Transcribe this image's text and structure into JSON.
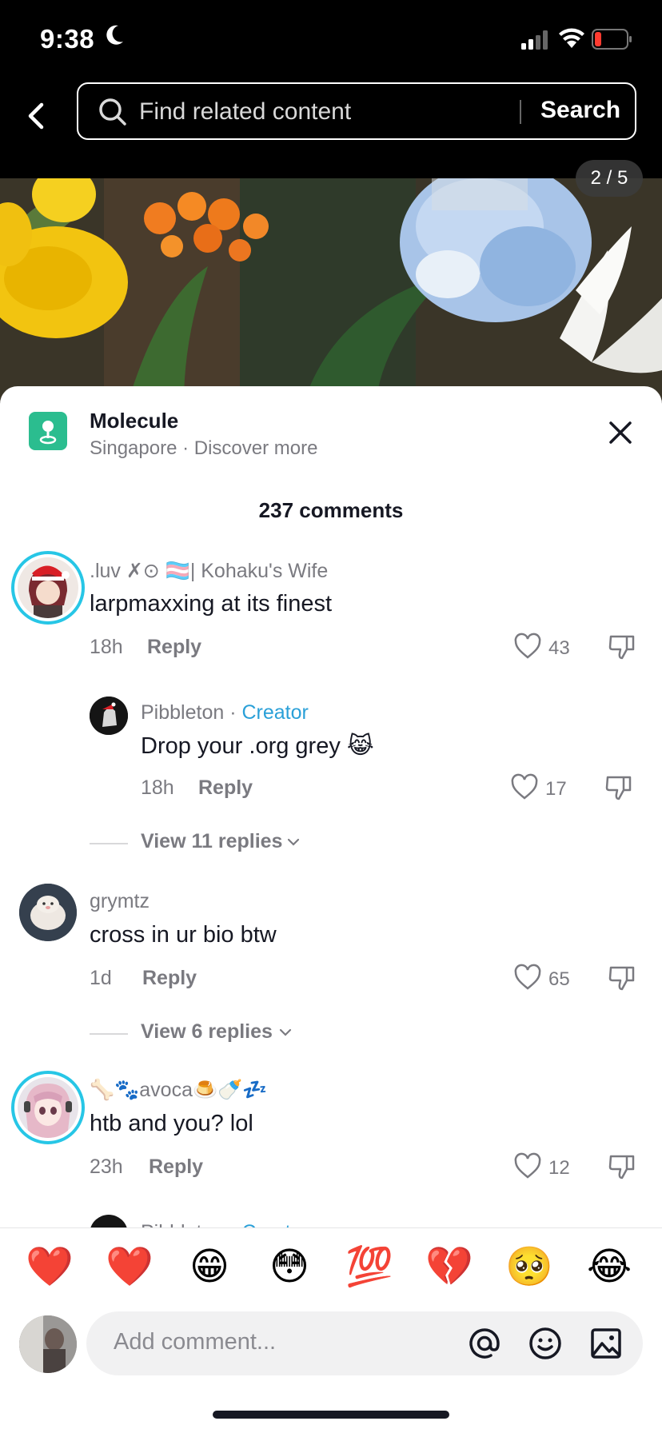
{
  "status_bar": {
    "time": "9:38"
  },
  "search": {
    "placeholder": "Find related content",
    "button": "Search"
  },
  "hero": {
    "page_indicator": "2 / 5"
  },
  "location": {
    "title": "Molecule",
    "subtitle": "Singapore · Discover more"
  },
  "comments_header": {
    "count_label": "237 comments"
  },
  "comments": [
    {
      "user": ".luv ✗⊙ 🏳️‍⚧️| Kohaku's Wife",
      "text": "larpmaxxing at its finest",
      "time": "18h",
      "reply": "Reply",
      "likes": "43"
    },
    {
      "user": "Pibbleton",
      "creator_sep": " · ",
      "creator": "Creator",
      "text": "Drop your .org grey 😹",
      "time": "18h",
      "reply": "Reply",
      "likes": "17"
    },
    {
      "user": "grymtz",
      "text": "cross in ur bio btw",
      "time": "1d",
      "reply": "Reply",
      "likes": "65"
    },
    {
      "user": "🦴🐾avoca🍮🍼💤",
      "text": "htb and you? lol",
      "time": "23h",
      "reply": "Reply",
      "likes": "12"
    },
    {
      "user": "Pibbleton",
      "creator_sep": " · ",
      "creator": "Creator"
    }
  ],
  "view_replies": [
    {
      "label": "View 11 replies"
    },
    {
      "label": "View 6 replies"
    }
  ],
  "emoji_bar": [
    "❤️",
    "❤️",
    "😁",
    "😳",
    "💯",
    "💔",
    "🥺",
    "😂"
  ],
  "comment_input": {
    "placeholder": "Add comment..."
  },
  "colors": {
    "accent": "#27c6e6",
    "creator": "#2aa0d8",
    "location_icon": "#2bbd8f"
  }
}
